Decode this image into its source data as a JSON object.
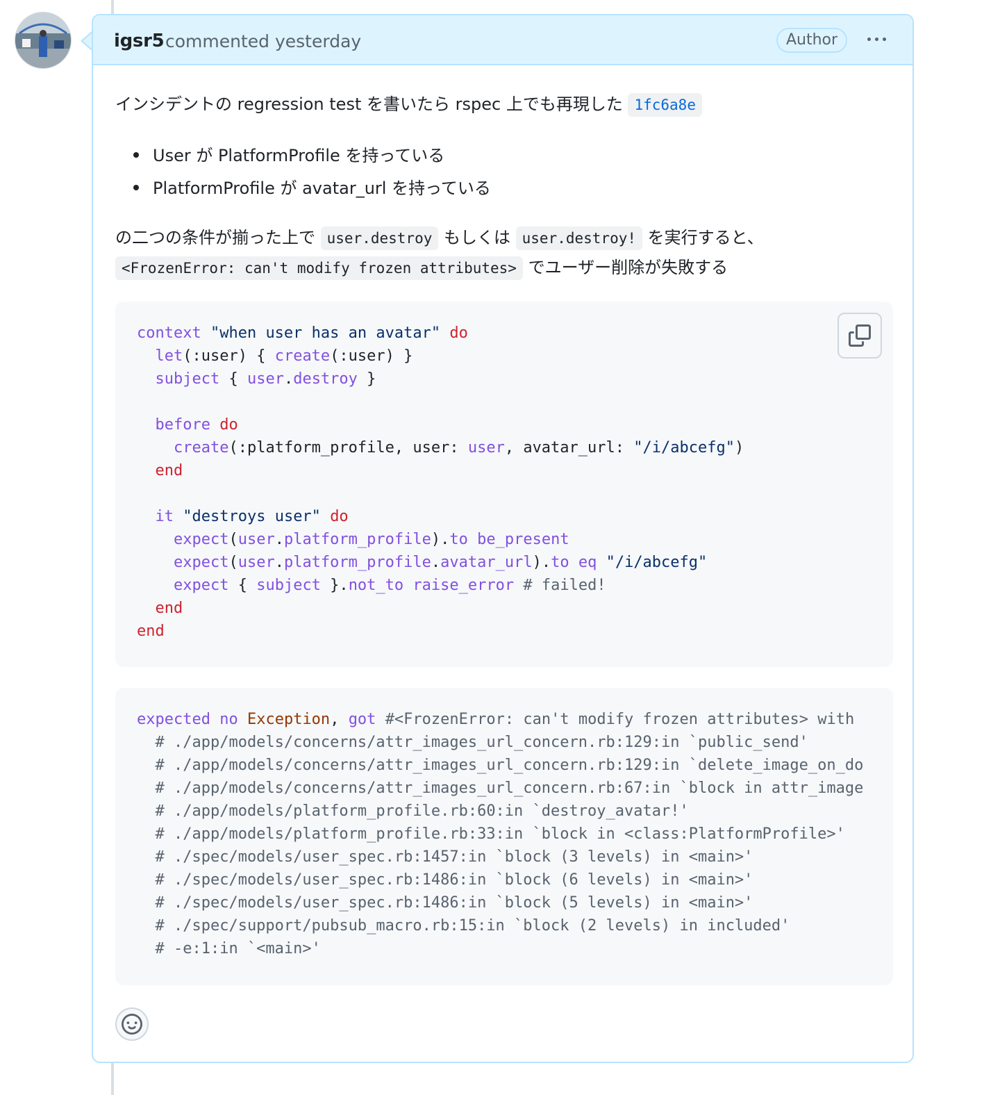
{
  "comment": {
    "author": "igsr5",
    "action": "commented yesterday",
    "badge": "Author",
    "more_icon": "kebab-horizontal-icon"
  },
  "body": {
    "p1_text": "インシデントの regression test を書いたら rspec 上でも再現した",
    "p1_commit": "1fc6a8e",
    "bullets": [
      "User が PlatformProfile を持っている",
      "PlatformProfile が avatar_url を持っている"
    ],
    "p2_text1": "の二つの条件が揃った上で",
    "p2_code1": "user.destroy",
    "p2_text2": "もしくは",
    "p2_code2": "user.destroy!",
    "p2_text3": "を実行すると、",
    "p3_code": "<FrozenError: can't modify frozen attributes>",
    "p3_text": "でユーザー削除が失敗する"
  },
  "code_block_1": {
    "language": "ruby",
    "lines": [
      "context \"when user has an avatar\" do",
      "  let(:user) { create(:user) }",
      "  subject { user.destroy }",
      "",
      "  before do",
      "    create(:platform_profile, user: user, avatar_url: \"/i/abcefg\")",
      "  end",
      "",
      "  it \"destroys user\" do",
      "    expect(user.platform_profile).to be_present",
      "    expect(user.platform_profile.avatar_url).to eq \"/i/abcefg\"",
      "    expect { subject }.not_to raise_error # failed!",
      "  end",
      "end"
    ],
    "copy_icon": "copy-icon"
  },
  "code_block_2": {
    "lines": [
      "expected no Exception, got #<FrozenError: can't modify frozen attributes> with",
      "  # ./app/models/concerns/attr_images_url_concern.rb:129:in `public_send'",
      "  # ./app/models/concerns/attr_images_url_concern.rb:129:in `delete_image_on_do",
      "  # ./app/models/concerns/attr_images_url_concern.rb:67:in `block in attr_image",
      "  # ./app/models/platform_profile.rb:60:in `destroy_avatar!'",
      "  # ./app/models/platform_profile.rb:33:in `block in <class:PlatformProfile>'",
      "  # ./spec/models/user_spec.rb:1457:in `block (3 levels) in <main>'",
      "  # ./spec/models/user_spec.rb:1486:in `block (6 levels) in <main>'",
      "  # ./spec/models/user_spec.rb:1486:in `block (5 levels) in <main>'",
      "  # ./spec/support/pubsub_macro.rb:15:in `block (2 levels) in included'",
      "  # -e:1:in `<main>'"
    ]
  },
  "reactions": {
    "icon": "smiley-icon"
  },
  "colors": {
    "header_bg": "#ddf4ff",
    "border": "#b6e3ff",
    "link": "#0969da",
    "keyword": "#cf222e",
    "function": "#8250df",
    "string": "#0a3069",
    "comment": "#59636e"
  }
}
